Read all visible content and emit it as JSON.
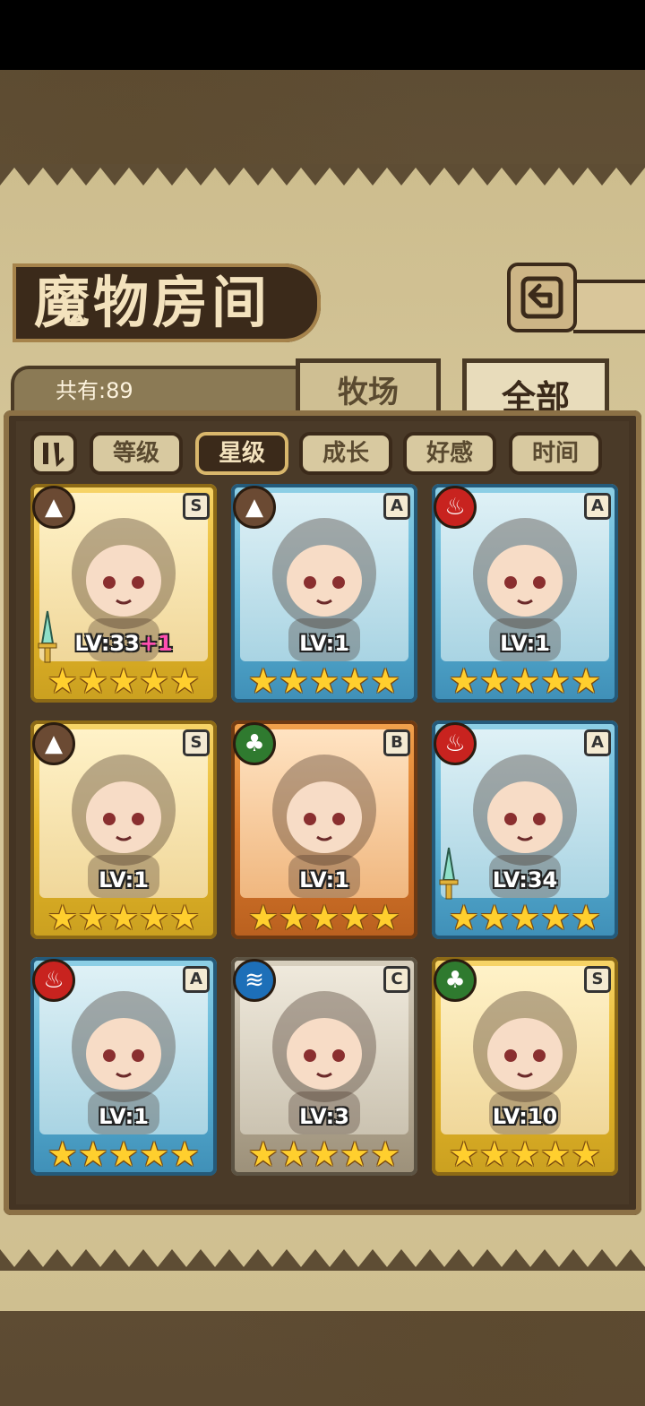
{
  "header": {
    "title": "魔物房间",
    "back_icon": "return-icon"
  },
  "summary": {
    "count_label": "共有:89"
  },
  "tabs": [
    {
      "label": "牧场",
      "active": false
    },
    {
      "label": "全部",
      "active": true
    }
  ],
  "sort": {
    "toggle_icon": "sort-direction-icon",
    "options": [
      {
        "label": "等级",
        "active": false
      },
      {
        "label": "星级",
        "active": true
      },
      {
        "label": "成长",
        "active": false
      },
      {
        "label": "好感",
        "active": false
      },
      {
        "label": "时间",
        "active": false
      }
    ]
  },
  "monsters": [
    {
      "element": "earth",
      "grade": "S",
      "frame": "gold",
      "level": "LV:33",
      "bonus": "+1",
      "stars": 5,
      "weapon": true
    },
    {
      "element": "earth",
      "grade": "A",
      "frame": "blue",
      "level": "LV:1",
      "bonus": "",
      "stars": 5,
      "weapon": false
    },
    {
      "element": "fire",
      "grade": "A",
      "frame": "blue",
      "level": "LV:1",
      "bonus": "",
      "stars": 5,
      "weapon": false
    },
    {
      "element": "earth",
      "grade": "S",
      "frame": "gold",
      "level": "LV:1",
      "bonus": "",
      "stars": 5,
      "weapon": false
    },
    {
      "element": "wood",
      "grade": "B",
      "frame": "orange",
      "level": "LV:1",
      "bonus": "",
      "stars": 5,
      "weapon": false
    },
    {
      "element": "fire",
      "grade": "A",
      "frame": "blue",
      "level": "LV:34",
      "bonus": "",
      "stars": 5,
      "weapon": true
    },
    {
      "element": "fire",
      "grade": "A",
      "frame": "blue",
      "level": "LV:1",
      "bonus": "",
      "stars": 5,
      "weapon": false
    },
    {
      "element": "water",
      "grade": "C",
      "frame": "silver",
      "level": "LV:3",
      "bonus": "",
      "stars": 5,
      "weapon": false
    },
    {
      "element": "wood",
      "grade": "S",
      "frame": "gold",
      "level": "LV:10",
      "bonus": "",
      "stars": 5,
      "weapon": false
    }
  ],
  "colors": {
    "earth": "#6b4a33",
    "fire": "#c8231f",
    "wood": "#2f7a2f",
    "water": "#1d6fb8"
  }
}
